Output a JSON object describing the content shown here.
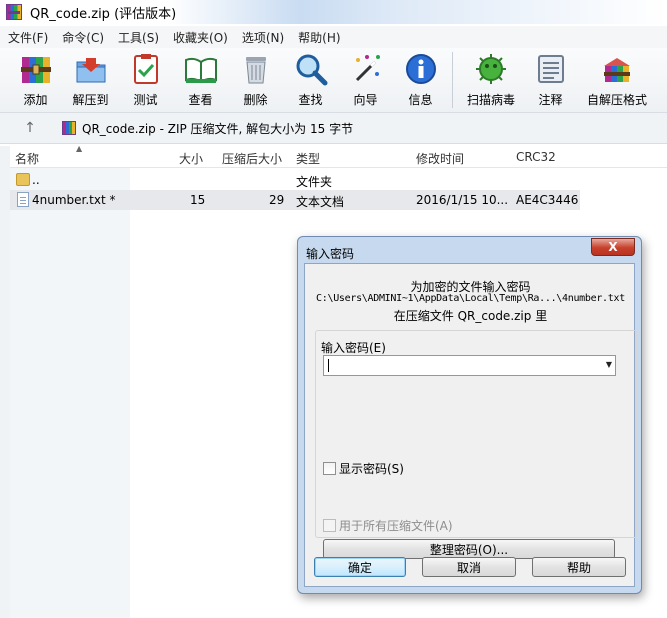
{
  "window": {
    "title": "QR_code.zip (评估版本)"
  },
  "menu": [
    "文件(F)",
    "命令(C)",
    "工具(S)",
    "收藏夹(O)",
    "选项(N)",
    "帮助(H)"
  ],
  "toolbar": [
    {
      "label": "添加",
      "icon": "add-archive-icon"
    },
    {
      "label": "解压到",
      "icon": "extract-to-icon"
    },
    {
      "label": "测试",
      "icon": "test-icon"
    },
    {
      "label": "查看",
      "icon": "view-book-icon"
    },
    {
      "label": "删除",
      "icon": "trash-icon"
    },
    {
      "label": "查找",
      "icon": "magnifier-icon"
    },
    {
      "label": "向导",
      "icon": "wizard-wand-icon"
    },
    {
      "label": "信息",
      "icon": "info-icon"
    },
    {
      "label": "扫描病毒",
      "icon": "virus-scan-icon"
    },
    {
      "label": "注释",
      "icon": "comment-icon"
    },
    {
      "label": "自解压格式",
      "icon": "sfx-icon"
    }
  ],
  "address": {
    "path": "QR_code.zip - ZIP 压缩文件, 解包大小为 15 字节"
  },
  "columns": {
    "name": "名称",
    "size": "大小",
    "packed": "压缩后大小",
    "type": "类型",
    "modified": "修改时间",
    "crc": "CRC32"
  },
  "files": [
    {
      "name": "..",
      "size": "",
      "packed": "",
      "type": "文件夹",
      "modified": "",
      "crc": ""
    },
    {
      "name": "4number.txt *",
      "size": "15",
      "packed": "29",
      "type": "文本文档",
      "modified": "2016/1/15 10...",
      "crc": "AE4C3446"
    }
  ],
  "dialog": {
    "title": "输入密码",
    "close": "X",
    "prompt_line1": "为加密的文件输入密码",
    "prompt_path": "C:\\Users\\ADMINI~1\\AppData\\Local\\Temp\\Ra...\\4number.txt",
    "prompt_line3": "在压缩文件 QR_code.zip 里",
    "password_label": "输入密码(E)",
    "password_value": "",
    "show_password": "显示密码(S)",
    "use_for_all": "用于所有压缩文件(A)",
    "organize": "整理密码(O)...",
    "ok": "确定",
    "cancel": "取消",
    "help": "帮助"
  },
  "colors": {
    "accent": "#3c7fb1",
    "close_button": "#c7402c",
    "dialog_frame": "#c6d9ef"
  }
}
